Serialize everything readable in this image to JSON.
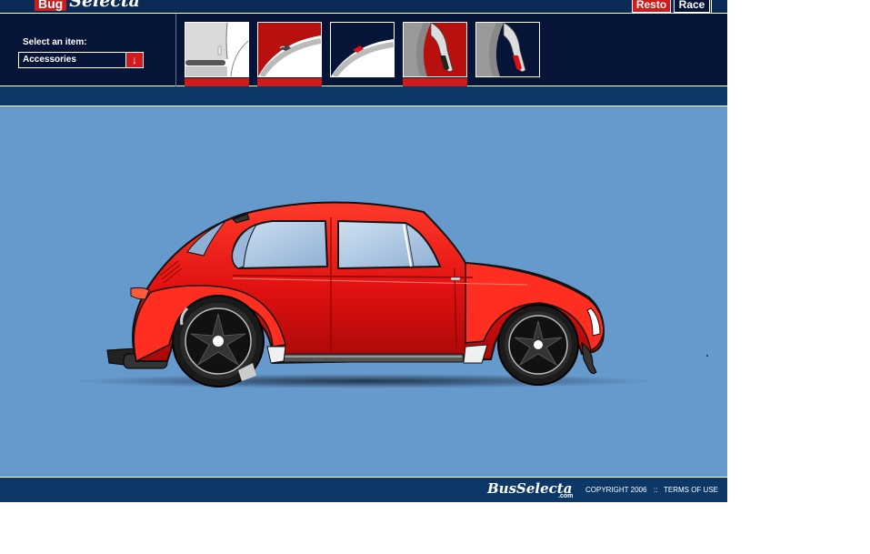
{
  "header": {
    "logo_primary": "Bug",
    "logo_secondary": "Selecta",
    "mode_tabs": [
      {
        "label": "Resto",
        "active": false,
        "color": "#cf1b1b"
      },
      {
        "label": "Race",
        "active": true,
        "color": "#061438"
      }
    ]
  },
  "selector": {
    "label": "Select an item:",
    "selected": "Accessories",
    "arrow_icon": "arrow-down-icon"
  },
  "thumbnails": [
    {
      "name": "side-trim",
      "has_bar": true
    },
    {
      "name": "fender-flare-red",
      "has_bar": true
    },
    {
      "name": "fender-flare-blue",
      "has_bar": false
    },
    {
      "name": "mudflap-red-bg",
      "has_bar": true
    },
    {
      "name": "mudflap-blue-bg",
      "has_bar": false
    }
  ],
  "car": {
    "body_color": "#e01010",
    "stage_color": "#6699cc"
  },
  "footer": {
    "brand": "BusSelecta",
    "brand_sub": ".com",
    "copyright": "COPYRIGHT 2006",
    "separator": "::",
    "terms": "TERMS OF USE"
  },
  "colors": {
    "navy": "#061438",
    "strip": "#0b3866",
    "accent_red": "#cf1b1b"
  }
}
